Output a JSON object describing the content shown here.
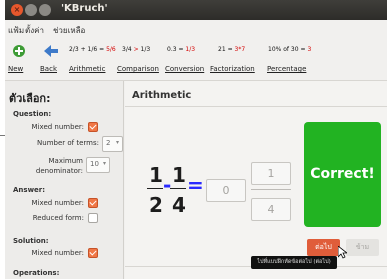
{
  "window": {
    "title": "'KBruch'"
  },
  "menubar": {
    "items": [
      "แฟ้ม",
      "ตั้งค่า",
      "ช่วยเหลือ"
    ]
  },
  "toolbar": {
    "new_label": "New",
    "back_label": "Back",
    "arithmetic_label": "Arithmetic",
    "comparison_label": "Comparison",
    "conversion_label": "Conversion",
    "factorization_label": "Factorization",
    "percentage_label": "Percentage",
    "arithmetic_example": {
      "a": "2/3",
      "op1": "+",
      "b": "1/6",
      "eq": "=",
      "result": "5/6"
    },
    "comparison_example": {
      "a": "3/4",
      "op": ">",
      "b": "1/3"
    },
    "conversion_example": {
      "left": "0.3",
      "eq": "=",
      "right": "1/3"
    },
    "factorization_example": {
      "left": "21",
      "eq": "=",
      "right": "3*7"
    },
    "percentage_example": {
      "left": "10% of 30",
      "eq": "=",
      "right": "3"
    }
  },
  "sidebar": {
    "title": "ตัวเลือก:",
    "question_heading": "Question:",
    "mixed_number_label": "Mixed number:",
    "mixed_number_checked": true,
    "number_of_terms_label": "Number of terms:",
    "number_of_terms_value": "2",
    "max_denominator_label_1": "Maximum",
    "max_denominator_label_2": "denominator:",
    "max_denominator_value": "10",
    "answer_heading": "Answer:",
    "answer_mixed_number_label": "Mixed number:",
    "answer_mixed_number_checked": true,
    "reduced_form_label": "Reduced form:",
    "reduced_form_checked": false,
    "solution_heading": "Solution:",
    "solution_mixed_number_label": "Mixed number:",
    "solution_mixed_number_checked": true,
    "operations_heading": "Operations:"
  },
  "main": {
    "title": "Arithmetic",
    "term1": {
      "numerator": "1",
      "denominator": "2"
    },
    "operator": "-",
    "term2": {
      "numerator": "1",
      "denominator": "4"
    },
    "equals": "=",
    "answer_whole": "0",
    "answer_numerator": "1",
    "answer_denominator": "4",
    "result_text": "Correct!",
    "next_button": "ต่อไป",
    "skip_button": "ข้าม",
    "tooltip": "ไปที่แบบฝึกหัดข้อต่อไป (ต่อไป)"
  },
  "colors": {
    "accent": "#f07746",
    "correct": "#22b322",
    "next_button": "#e05d3a",
    "operator": "#2a2aff"
  }
}
